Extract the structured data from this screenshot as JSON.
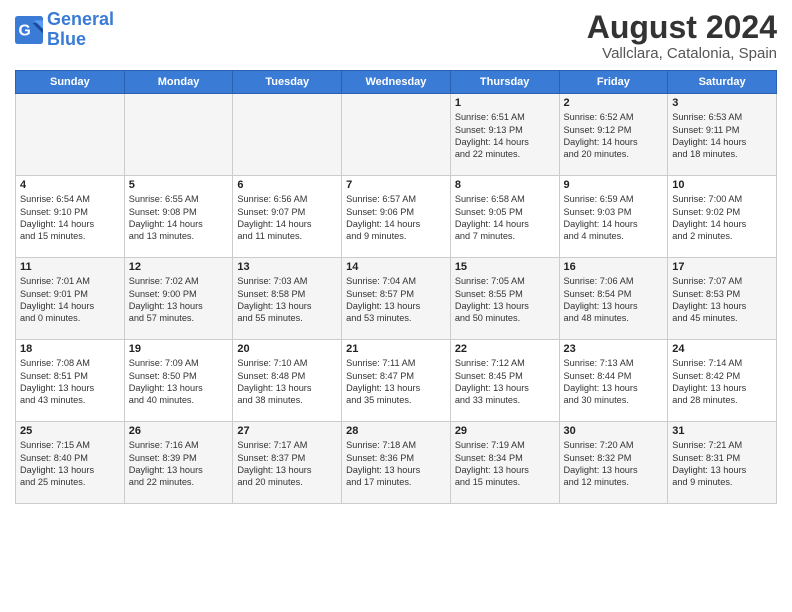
{
  "header": {
    "logo_line1": "General",
    "logo_line2": "Blue",
    "title": "August 2024",
    "subtitle": "Vallclara, Catalonia, Spain"
  },
  "calendar": {
    "days_of_week": [
      "Sunday",
      "Monday",
      "Tuesday",
      "Wednesday",
      "Thursday",
      "Friday",
      "Saturday"
    ],
    "weeks": [
      [
        {
          "day": "",
          "info": ""
        },
        {
          "day": "",
          "info": ""
        },
        {
          "day": "",
          "info": ""
        },
        {
          "day": "",
          "info": ""
        },
        {
          "day": "1",
          "info": "Sunrise: 6:51 AM\nSunset: 9:13 PM\nDaylight: 14 hours\nand 22 minutes."
        },
        {
          "day": "2",
          "info": "Sunrise: 6:52 AM\nSunset: 9:12 PM\nDaylight: 14 hours\nand 20 minutes."
        },
        {
          "day": "3",
          "info": "Sunrise: 6:53 AM\nSunset: 9:11 PM\nDaylight: 14 hours\nand 18 minutes."
        }
      ],
      [
        {
          "day": "4",
          "info": "Sunrise: 6:54 AM\nSunset: 9:10 PM\nDaylight: 14 hours\nand 15 minutes."
        },
        {
          "day": "5",
          "info": "Sunrise: 6:55 AM\nSunset: 9:08 PM\nDaylight: 14 hours\nand 13 minutes."
        },
        {
          "day": "6",
          "info": "Sunrise: 6:56 AM\nSunset: 9:07 PM\nDaylight: 14 hours\nand 11 minutes."
        },
        {
          "day": "7",
          "info": "Sunrise: 6:57 AM\nSunset: 9:06 PM\nDaylight: 14 hours\nand 9 minutes."
        },
        {
          "day": "8",
          "info": "Sunrise: 6:58 AM\nSunset: 9:05 PM\nDaylight: 14 hours\nand 7 minutes."
        },
        {
          "day": "9",
          "info": "Sunrise: 6:59 AM\nSunset: 9:03 PM\nDaylight: 14 hours\nand 4 minutes."
        },
        {
          "day": "10",
          "info": "Sunrise: 7:00 AM\nSunset: 9:02 PM\nDaylight: 14 hours\nand 2 minutes."
        }
      ],
      [
        {
          "day": "11",
          "info": "Sunrise: 7:01 AM\nSunset: 9:01 PM\nDaylight: 14 hours\nand 0 minutes."
        },
        {
          "day": "12",
          "info": "Sunrise: 7:02 AM\nSunset: 9:00 PM\nDaylight: 13 hours\nand 57 minutes."
        },
        {
          "day": "13",
          "info": "Sunrise: 7:03 AM\nSunset: 8:58 PM\nDaylight: 13 hours\nand 55 minutes."
        },
        {
          "day": "14",
          "info": "Sunrise: 7:04 AM\nSunset: 8:57 PM\nDaylight: 13 hours\nand 53 minutes."
        },
        {
          "day": "15",
          "info": "Sunrise: 7:05 AM\nSunset: 8:55 PM\nDaylight: 13 hours\nand 50 minutes."
        },
        {
          "day": "16",
          "info": "Sunrise: 7:06 AM\nSunset: 8:54 PM\nDaylight: 13 hours\nand 48 minutes."
        },
        {
          "day": "17",
          "info": "Sunrise: 7:07 AM\nSunset: 8:53 PM\nDaylight: 13 hours\nand 45 minutes."
        }
      ],
      [
        {
          "day": "18",
          "info": "Sunrise: 7:08 AM\nSunset: 8:51 PM\nDaylight: 13 hours\nand 43 minutes."
        },
        {
          "day": "19",
          "info": "Sunrise: 7:09 AM\nSunset: 8:50 PM\nDaylight: 13 hours\nand 40 minutes."
        },
        {
          "day": "20",
          "info": "Sunrise: 7:10 AM\nSunset: 8:48 PM\nDaylight: 13 hours\nand 38 minutes."
        },
        {
          "day": "21",
          "info": "Sunrise: 7:11 AM\nSunset: 8:47 PM\nDaylight: 13 hours\nand 35 minutes."
        },
        {
          "day": "22",
          "info": "Sunrise: 7:12 AM\nSunset: 8:45 PM\nDaylight: 13 hours\nand 33 minutes."
        },
        {
          "day": "23",
          "info": "Sunrise: 7:13 AM\nSunset: 8:44 PM\nDaylight: 13 hours\nand 30 minutes."
        },
        {
          "day": "24",
          "info": "Sunrise: 7:14 AM\nSunset: 8:42 PM\nDaylight: 13 hours\nand 28 minutes."
        }
      ],
      [
        {
          "day": "25",
          "info": "Sunrise: 7:15 AM\nSunset: 8:40 PM\nDaylight: 13 hours\nand 25 minutes."
        },
        {
          "day": "26",
          "info": "Sunrise: 7:16 AM\nSunset: 8:39 PM\nDaylight: 13 hours\nand 22 minutes."
        },
        {
          "day": "27",
          "info": "Sunrise: 7:17 AM\nSunset: 8:37 PM\nDaylight: 13 hours\nand 20 minutes."
        },
        {
          "day": "28",
          "info": "Sunrise: 7:18 AM\nSunset: 8:36 PM\nDaylight: 13 hours\nand 17 minutes."
        },
        {
          "day": "29",
          "info": "Sunrise: 7:19 AM\nSunset: 8:34 PM\nDaylight: 13 hours\nand 15 minutes."
        },
        {
          "day": "30",
          "info": "Sunrise: 7:20 AM\nSunset: 8:32 PM\nDaylight: 13 hours\nand 12 minutes."
        },
        {
          "day": "31",
          "info": "Sunrise: 7:21 AM\nSunset: 8:31 PM\nDaylight: 13 hours\nand 9 minutes."
        }
      ]
    ]
  }
}
